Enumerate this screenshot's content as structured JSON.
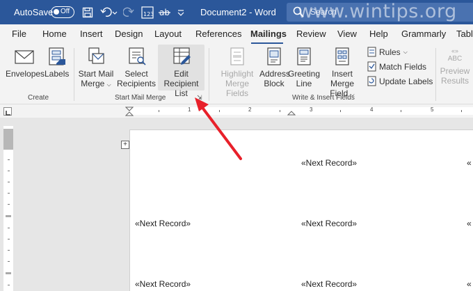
{
  "titlebar": {
    "autosave_label": "AutoSave",
    "autosave_state": "Off",
    "doc_title": "Document2  -  Word",
    "search_placeholder": "Search",
    "watermark": "www.wintips.org"
  },
  "tabs": [
    "File",
    "Home",
    "Insert",
    "Design",
    "Layout",
    "References",
    "Mailings",
    "Review",
    "View",
    "Help",
    "Grammarly",
    "Tabl"
  ],
  "active_tab": "Mailings",
  "ribbon": {
    "create": {
      "label": "Create",
      "envelopes": "Envelopes",
      "labels": "Labels"
    },
    "start_mail_merge": {
      "label": "Start Mail Merge",
      "start_line1": "Start Mail",
      "start_line2": "Merge",
      "select_line1": "Select",
      "select_line2": "Recipients",
      "edit_line1": "Edit",
      "edit_line2": "Recipient List"
    },
    "write_insert": {
      "label": "Write & Insert Fields",
      "highlight_line1": "Highlight",
      "highlight_line2": "Merge Fields",
      "address_line1": "Address",
      "address_line2": "Block",
      "greeting_line1": "Greeting",
      "greeting_line2": "Line",
      "insert_line1": "Insert Merge",
      "insert_line2": "Field",
      "rules": "Rules",
      "match_fields": "Match Fields",
      "update_labels": "Update Labels"
    },
    "preview": {
      "abc": "ABC",
      "line1": "Preview",
      "line2": "Results"
    }
  },
  "ruler_numbers": [
    "1",
    "2",
    "3",
    "4",
    "5"
  ],
  "document": {
    "next_record": "«Next Record»"
  },
  "colors": {
    "titlebar": "#2b579a",
    "arrow": "#e8202a",
    "ribbon": "#f3f3f3"
  }
}
